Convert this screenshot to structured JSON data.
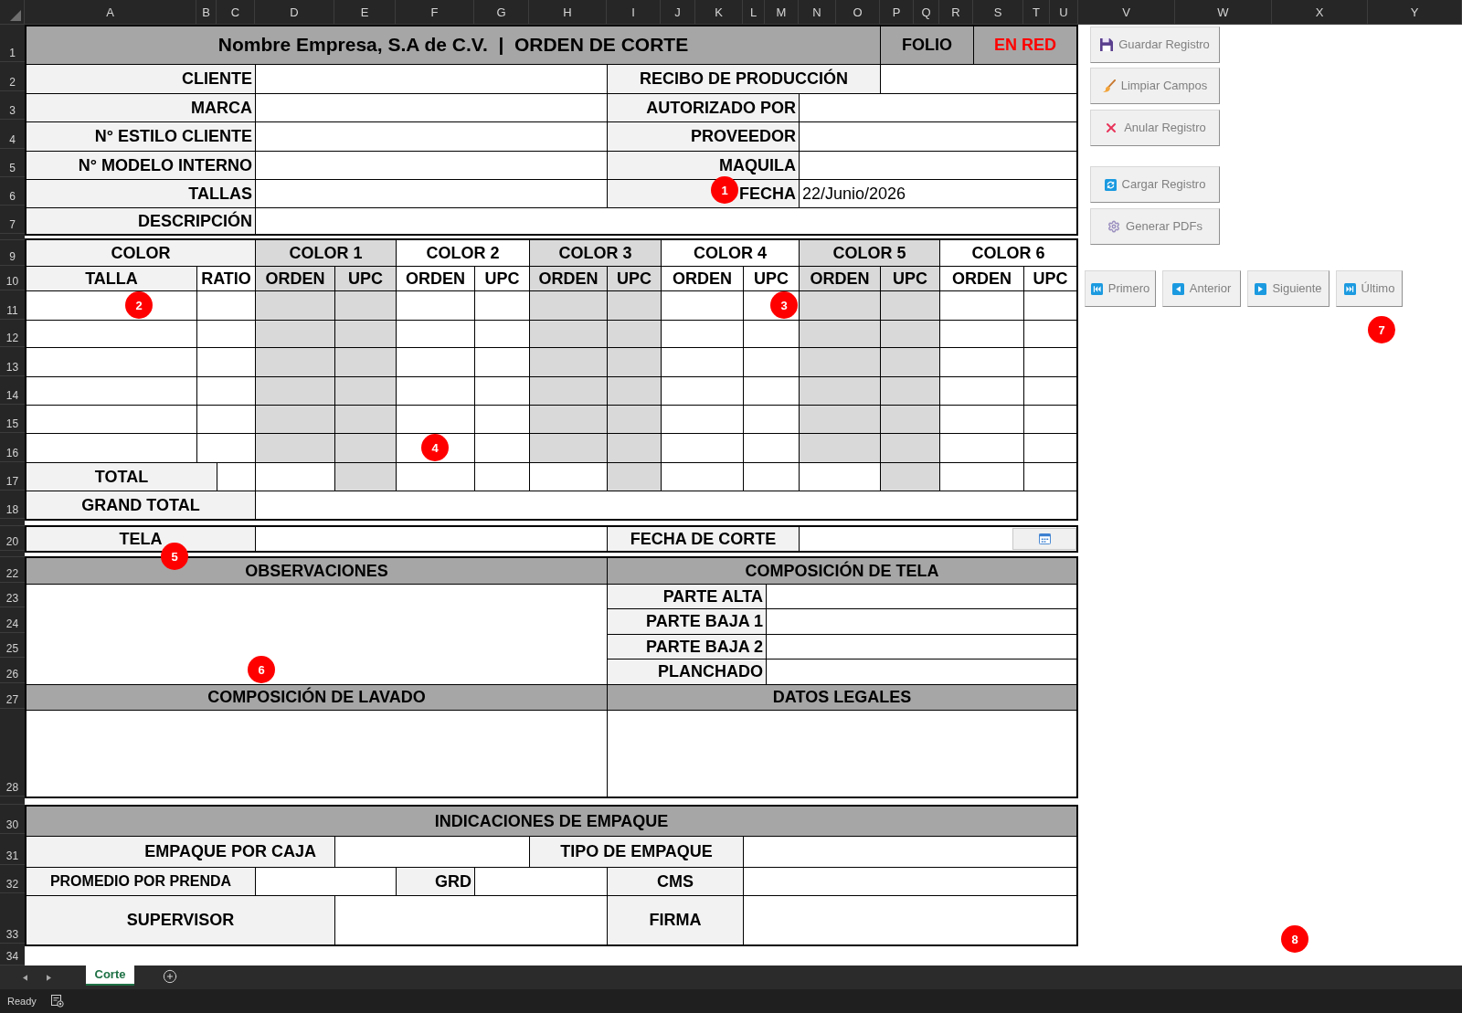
{
  "column_headers": [
    "A",
    "B",
    "C",
    "D",
    "E",
    "F",
    "G",
    "H",
    "I",
    "J",
    "K",
    "L",
    "M",
    "N",
    "O",
    "P",
    "Q",
    "R",
    "S",
    "T",
    "U",
    "V",
    "W",
    "X",
    "Y"
  ],
  "row_numbers": [
    "1",
    "2",
    "3",
    "4",
    "5",
    "6",
    "7",
    "9",
    "10",
    "11",
    "12",
    "13",
    "14",
    "15",
    "16",
    "17",
    "18",
    "20",
    "22",
    "23",
    "24",
    "25",
    "26",
    "27",
    "28",
    "30",
    "31",
    "32",
    "33",
    "34"
  ],
  "header": {
    "title": "Nombre Empresa, S.A de C.V.  |  ORDEN DE CORTE",
    "folio_label": "FOLIO",
    "folio_value": "EN RED"
  },
  "general_fields": {
    "left": [
      {
        "label": "CLIENTE"
      },
      {
        "label": "MARCA"
      },
      {
        "label": "N° ESTILO CLIENTE"
      },
      {
        "label": "N° MODELO INTERNO"
      },
      {
        "label": "TALLAS"
      },
      {
        "label": "DESCRIPCIÓN"
      }
    ],
    "right": [
      {
        "label": "RECIBO DE PRODUCCIÓN"
      },
      {
        "label": "AUTORIZADO POR"
      },
      {
        "label": "PROVEEDOR"
      },
      {
        "label": "MAQUILA"
      },
      {
        "label": "FECHA",
        "value": "22/Junio/2026"
      }
    ]
  },
  "color_table": {
    "color_label": "COLOR",
    "size_label": "TALLA",
    "ratio_label": "RATIO",
    "colors": [
      {
        "label": "COLOR 1",
        "shaded": true,
        "columns": [
          "ORDEN",
          "UPC"
        ]
      },
      {
        "label": "COLOR 2",
        "shaded": false,
        "columns": [
          "ORDEN",
          "UPC"
        ]
      },
      {
        "label": "COLOR 3",
        "shaded": true,
        "columns": [
          "ORDEN",
          "UPC"
        ]
      },
      {
        "label": "COLOR 4",
        "shaded": false,
        "columns": [
          "ORDEN",
          "UPC"
        ]
      },
      {
        "label": "COLOR 5",
        "shaded": true,
        "columns": [
          "ORDEN",
          "UPC"
        ]
      },
      {
        "label": "COLOR 6",
        "shaded": false,
        "columns": [
          "ORDEN",
          "UPC"
        ]
      }
    ],
    "total_label": "TOTAL",
    "grand_total_label": "GRAND TOTAL"
  },
  "fabric_row": {
    "fabric_label": "TELA",
    "cut_date_label": "FECHA DE CORTE"
  },
  "notes": {
    "observations_title": "OBSERVACIONES",
    "fabric_composition": {
      "title": "COMPOSICIÓN DE TELA",
      "parts": [
        {
          "label": "PARTE ALTA"
        },
        {
          "label": "PARTE BAJA 1"
        },
        {
          "label": "PARTE BAJA 2"
        },
        {
          "label": "PLANCHADO"
        }
      ]
    },
    "washing_title": "COMPOSICIÓN DE LAVADO",
    "legal_title": "DATOS LEGALES"
  },
  "packing": {
    "title": "INDICACIONES DE EMPAQUE",
    "per_box_label": "EMPAQUE POR CAJA",
    "pack_type_label": "TIPO DE EMPAQUE",
    "avg_per_garment_label": "PROMEDIO POR PRENDA",
    "grd_label": "GRD",
    "cms_label": "CMS",
    "supervisor_label": "SUPERVISOR",
    "signature_label": "FIRMA"
  },
  "action_buttons": [
    {
      "label": "Guardar Registro",
      "kind": "save"
    },
    {
      "label": "Limpiar Campos",
      "kind": "clear"
    },
    {
      "label": "Anular Registro",
      "kind": "void"
    },
    {
      "label": "Cargar Registro",
      "kind": "load"
    },
    {
      "label": "Generar PDFs",
      "kind": "pdf"
    }
  ],
  "navigation_buttons": [
    {
      "label": "Primero",
      "kind": "first"
    },
    {
      "label": "Anterior",
      "kind": "previous"
    },
    {
      "label": "Siguiente",
      "kind": "next"
    },
    {
      "label": "Último",
      "kind": "last"
    }
  ],
  "sheet_tabs": [
    {
      "label": "Corte",
      "selected": true
    }
  ],
  "status_bar": {
    "text": "Ready"
  },
  "annotation_markers": [
    {
      "label": "1"
    },
    {
      "label": "2"
    },
    {
      "label": "3"
    },
    {
      "label": "4"
    },
    {
      "label": "5"
    },
    {
      "label": "6"
    },
    {
      "label": "7"
    },
    {
      "label": "8"
    }
  ]
}
